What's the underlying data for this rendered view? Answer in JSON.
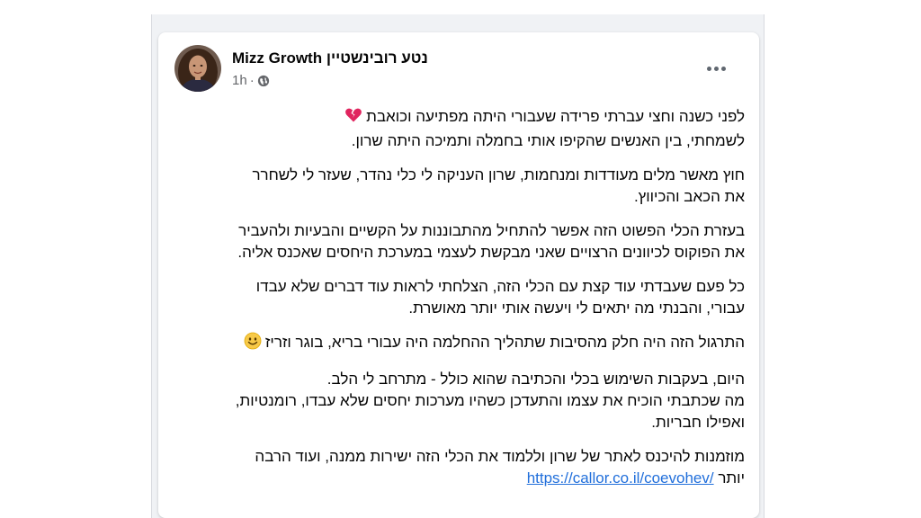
{
  "post": {
    "author_hebrew": "נטע רובינשטיין",
    "author_brand": "Mizz Growth",
    "time": "1h",
    "meta_separator": "·",
    "privacy_icon": "globe-icon",
    "more_icon": "more-options-icon",
    "paragraphs": [
      {
        "lines": [
          "לפני כשנה וחצי עברתי פרידה שעבורי היתה מפתיעה וכואבת",
          "לשמחתי, בין האנשים שהקיפו אותי בחמלה ותמיכה היתה שרון."
        ],
        "emoji": "broken-heart"
      },
      {
        "lines": [
          "חוץ מאשר מלים מעודדות ומנחמות, שרון העניקה לי כלי נהדר, שעזר לי לשחרר",
          "את הכאב והכיווץ."
        ]
      },
      {
        "lines": [
          "בעזרת הכלי הפשוט הזה אפשר להתחיל מהתבוננות על הקשיים והבעיות ולהעביר",
          "את הפוקוס לכיוונים הרצויים שאני מבקשת לעצמי במערכת היחסים שאכנס אליה."
        ]
      },
      {
        "lines": [
          "כל פעם שעבדתי עוד קצת עם הכלי הזה, הצלחתי לראות עוד דברים שלא עבדו",
          "עבורי, והבנתי מה יתאים לי ויעשה אותי יותר מאושרת."
        ]
      },
      {
        "lines": [
          "התרגול הזה היה חלק מהסיבות שתהליך ההחלמה היה עבורי בריא, בוגר וזריז"
        ],
        "emoji": "smile"
      },
      {
        "lines": [
          "היום, בעקבות השימוש בכלי והכתיבה שהוא כולל - מתרחב לי הלב.",
          "מה שכתבתי הוכיח את עצמו והתעדכן כשהיו מערכות יחסים שלא עבדו, רומנטיות,",
          "ואפילו חבריות."
        ]
      },
      {
        "lines": [
          "מוזמנות להיכנס לאתר של שרון וללמוד את הכלי הזה ישירות ממנה, ועוד הרבה"
        ],
        "last_line_text": "יותר",
        "link": "https://callor.co.il/coevohev/"
      }
    ]
  }
}
